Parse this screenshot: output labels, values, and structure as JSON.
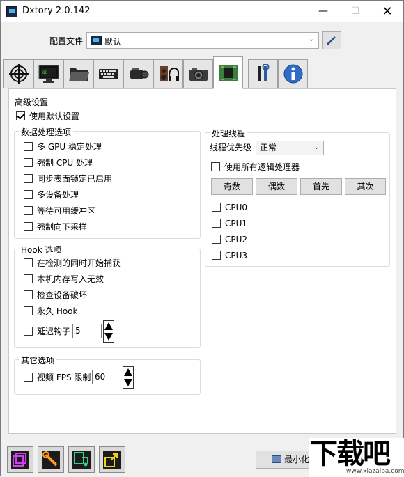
{
  "window": {
    "title": "Dxtory 2.0.142"
  },
  "config": {
    "label": "配置文件",
    "selected": "默认"
  },
  "tabs": [
    {
      "icon": "crosshair-icon"
    },
    {
      "icon": "monitor-icon"
    },
    {
      "icon": "folder-icon"
    },
    {
      "icon": "keyboard-icon"
    },
    {
      "icon": "camcorder-icon"
    },
    {
      "icon": "audio-icon"
    },
    {
      "icon": "camera-icon"
    },
    {
      "icon": "chip-icon"
    },
    {
      "icon": "tools-icon"
    },
    {
      "icon": "info-icon"
    }
  ],
  "advanced": {
    "title": "高级设置",
    "use_default": "使用默认设置",
    "data_processing": {
      "title": "数据处理选项",
      "items": [
        "多 GPU 稳定处理",
        "强制 CPU 处理",
        "同步表面锁定已启用",
        "多设备处理",
        "等待可用缓冲区",
        "强制向下采样"
      ]
    },
    "hook": {
      "title": "Hook 选项",
      "items": [
        "在检测的同时开始捕获",
        "本机内存写入无效",
        "检查设备破坏",
        "永久 Hook"
      ],
      "delay_label": "延迟钩子",
      "delay_value": "5"
    },
    "other": {
      "title": "其它选项",
      "fps_label": "视频 FPS 限制",
      "fps_value": "60"
    },
    "thread": {
      "title": "处理线程",
      "priority_label": "线程优先级",
      "priority_value": "正常",
      "use_all": "使用所有逻辑处理器",
      "buttons": [
        "奇数",
        "偶数",
        "首先",
        "其次"
      ],
      "cpus": [
        "CPU0",
        "CPU1",
        "CPU2",
        "CPU3"
      ]
    }
  },
  "bottom": {
    "icons": [
      "windows-icon",
      "wrench-icon",
      "media-icon",
      "export-icon"
    ],
    "minimize_label": "最小化"
  },
  "watermark": {
    "main": "下载吧",
    "sub": "www.xiazaiba.com"
  }
}
